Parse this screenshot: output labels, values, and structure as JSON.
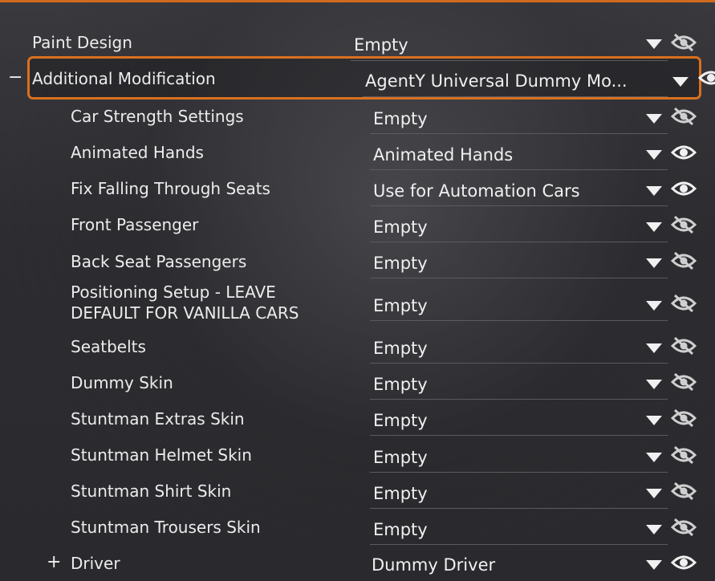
{
  "rows": [
    {
      "label": "Paint Design",
      "value": "Empty",
      "eye": "eye-off-icon"
    },
    {
      "label": "Additional Modification",
      "value": "AgentY Universal Dummy Mo...",
      "eye": "eye-icon",
      "toggle": "−"
    },
    {
      "label": "Car Strength Settings",
      "value": "Empty",
      "eye": "eye-off-icon"
    },
    {
      "label": "Animated Hands",
      "value": "Animated Hands",
      "eye": "eye-icon"
    },
    {
      "label": "Fix Falling Through Seats",
      "value": "Use for Automation Cars",
      "eye": "eye-icon"
    },
    {
      "label": "Front Passenger",
      "value": "Empty",
      "eye": "eye-off-icon"
    },
    {
      "label": "Back Seat Passengers",
      "value": "Empty",
      "eye": "eye-off-icon"
    },
    {
      "label": "Positioning Setup - LEAVE DEFAULT FOR VANILLA CARS",
      "value": "Empty",
      "eye": "eye-off-icon"
    },
    {
      "label": "Seatbelts",
      "value": "Empty",
      "eye": "eye-off-icon"
    },
    {
      "label": "Dummy Skin",
      "value": "Empty",
      "eye": "eye-off-icon"
    },
    {
      "label": "Stuntman Extras Skin",
      "value": "Empty",
      "eye": "eye-off-icon"
    },
    {
      "label": "Stuntman Helmet Skin",
      "value": "Empty",
      "eye": "eye-off-icon"
    },
    {
      "label": "Stuntman Shirt Skin",
      "value": "Empty",
      "eye": "eye-off-icon"
    },
    {
      "label": "Stuntman Trousers Skin",
      "value": "Empty",
      "eye": "eye-off-icon"
    },
    {
      "label": "Driver",
      "value": "Dummy Driver",
      "eye": "eye-icon",
      "toggle": "+"
    }
  ],
  "colors": {
    "accent": "#d9701f",
    "text": "#ececec",
    "underline": "#5a5a60"
  }
}
